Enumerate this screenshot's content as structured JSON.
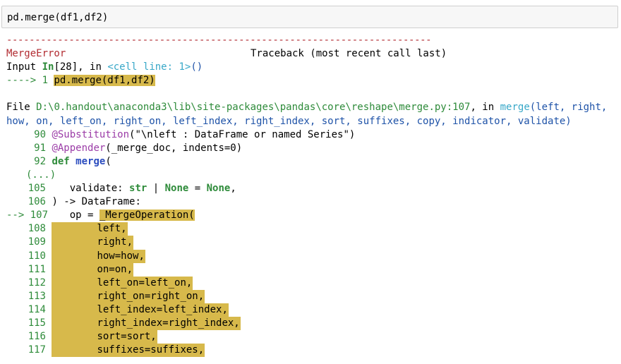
{
  "input": {
    "code": "pd.merge(df1,df2)"
  },
  "separator": "---------------------------------------------------------------------------",
  "error": {
    "name": "MergeError",
    "traceback_label": "Traceback (most recent call last)",
    "input_prefix": "Input ",
    "input_word": "In",
    "input_cell": "[28]",
    "input_sep": ", in ",
    "cell_line": "<cell line: 1>",
    "call_parens": "()",
    "arrow1": "----> 1 ",
    "arrow1_code": "pd.merge(df1,df2)",
    "file_prefix": "File ",
    "file_path": "D:\\0.handout\\anaconda3\\lib\\site-packages\\pandas\\core\\reshape\\merge.py:107",
    "file_in": ", in ",
    "func_name": "merge",
    "func_sig": "(left, right, how, on, left_on, right_on, left_index, right_index, sort, suffixes, copy, indicator, validate)"
  },
  "code_lines": {
    "l90": {
      "num": "90",
      "dec": "@Substitution",
      "args": "(\"\\nleft : DataFrame or named Series\")"
    },
    "l91": {
      "num": "91",
      "dec": "@Appender",
      "args": "(_merge_doc, indents=0)"
    },
    "l92": {
      "num": "92",
      "kw": "def",
      "name": " merge",
      "rest": "("
    },
    "ellipsis": "(...)",
    "l105": {
      "num": "105",
      "pre": "validate: ",
      "type": "str",
      "bar": " | ",
      "none1": "None",
      "eq": " = ",
      "none2": "None",
      "post": ","
    },
    "l106": {
      "num": "106",
      "text": ") -> DataFrame:"
    },
    "l107": {
      "arrow": "--> 107",
      "pre": "op = ",
      "hl": "_MergeOperation("
    },
    "rows": [
      {
        "num": "108",
        "text": "left,"
      },
      {
        "num": "109",
        "text": "right,"
      },
      {
        "num": "110",
        "text": "how=how,"
      },
      {
        "num": "111",
        "text": "on=on,"
      },
      {
        "num": "112",
        "text": "left_on=left_on,"
      },
      {
        "num": "113",
        "text": "right_on=right_on,"
      },
      {
        "num": "114",
        "text": "left_index=left_index,"
      },
      {
        "num": "115",
        "text": "right_index=right_index,"
      },
      {
        "num": "116",
        "text": "sort=sort,"
      },
      {
        "num": "117",
        "text": "suffixes=suffixes,"
      }
    ]
  }
}
